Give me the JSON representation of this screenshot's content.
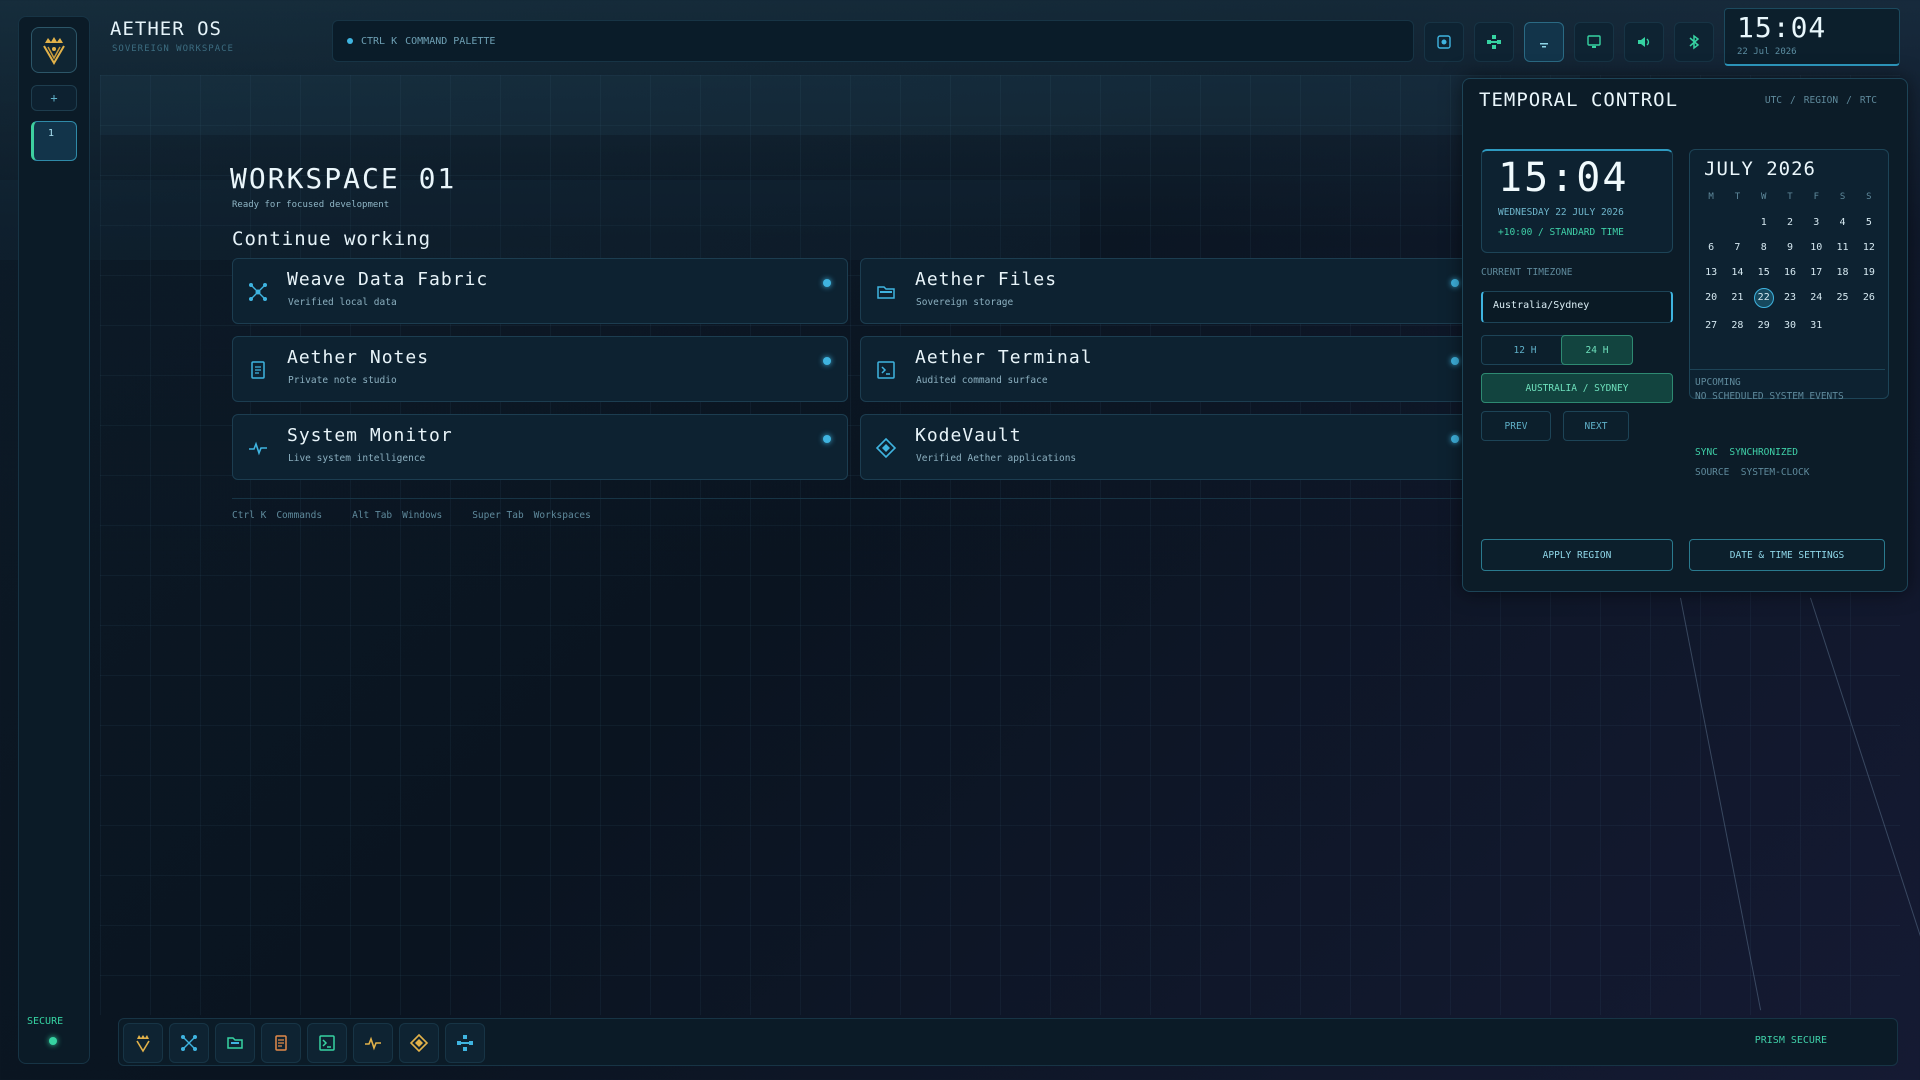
{
  "brand": {
    "title": "AETHER OS",
    "subtitle": "SOVEREIGN WORKSPACE"
  },
  "rail": {
    "new_label": "+",
    "workspace_label": "1",
    "status": "SECURE"
  },
  "command": {
    "shortcut": "CTRL K",
    "label": "COMMAND PALETTE"
  },
  "tray_icons": [
    "screen-capture-icon",
    "network-icon",
    "wifi-icon",
    "display-icon",
    "volume-icon",
    "bluetooth-icon"
  ],
  "clock": {
    "time": "15:04",
    "date": "22 Jul 2026"
  },
  "workspace": {
    "title": "WORKSPACE 01",
    "subtitle": "Ready for focused development",
    "section": "Continue working",
    "apps": [
      {
        "name": "Weave Data Fabric",
        "desc": "Verified local data",
        "icon": "data-fabric-icon"
      },
      {
        "name": "Aether Files",
        "desc": "Sovereign storage",
        "icon": "folder-icon"
      },
      {
        "name": "Aether Notes",
        "desc": "Private note studio",
        "icon": "notes-icon"
      },
      {
        "name": "Aether Terminal",
        "desc": "Audited command surface",
        "icon": "terminal-icon"
      },
      {
        "name": "System Monitor",
        "desc": "Live system intelligence",
        "icon": "pulse-icon"
      },
      {
        "name": "KodeVault",
        "desc": "Verified Aether applications",
        "icon": "vault-icon"
      }
    ],
    "hints": [
      {
        "key": "Ctrl K",
        "label": "Commands"
      },
      {
        "key": "Alt Tab",
        "label": "Windows"
      },
      {
        "key": "Super Tab",
        "label": "Workspaces"
      }
    ]
  },
  "temporal": {
    "title": "TEMPORAL CONTROL",
    "tabs": [
      "UTC",
      "/",
      "REGION",
      "/",
      "RTC"
    ],
    "time": "15:04",
    "date_line": "WEDNESDAY  22 JULY 2026",
    "zone_line": "+10:00  /  STANDARD TIME",
    "timezone_label": "CURRENT TIMEZONE",
    "timezone_value": "Australia/Sydney",
    "btn_12h": "12 H",
    "btn_24h": "24 H",
    "region_button": "AUSTRALIA / SYDNEY",
    "prev": "PREV",
    "next": "NEXT",
    "calendar_title": "JULY 2026",
    "weekdays": [
      "M",
      "T",
      "W",
      "T",
      "F",
      "S",
      "S"
    ],
    "days": [
      "",
      "",
      "1",
      "2",
      "3",
      "4",
      "5",
      "6",
      "7",
      "8",
      "9",
      "10",
      "11",
      "12",
      "13",
      "14",
      "15",
      "16",
      "17",
      "18",
      "19",
      "20",
      "21",
      "22",
      "23",
      "24",
      "25",
      "26",
      "27",
      "28",
      "29",
      "30",
      "31",
      "",
      "",
      ""
    ],
    "today": "22",
    "upcoming_label": "UPCOMING",
    "upcoming_value": "NO SCHEDULED SYSTEM EVENTS",
    "sync_label": "SYNC",
    "sync_value": "SYNCHRONIZED",
    "source_label": "SOURCE",
    "source_value": "SYSTEM-CLOCK",
    "apply_button": "APPLY REGION",
    "settings_button": "DATE & TIME SETTINGS"
  },
  "dock": {
    "items": [
      "aether-crest-icon",
      "data-fabric-icon",
      "folder-icon",
      "notes-icon",
      "terminal-icon",
      "pulse-icon",
      "vault-icon",
      "network-icon"
    ],
    "status": "PRISM SECURE"
  },
  "colors": {
    "accent": "#3fb4e0",
    "secure": "#36d3a2",
    "gold": "#e2b24a"
  }
}
